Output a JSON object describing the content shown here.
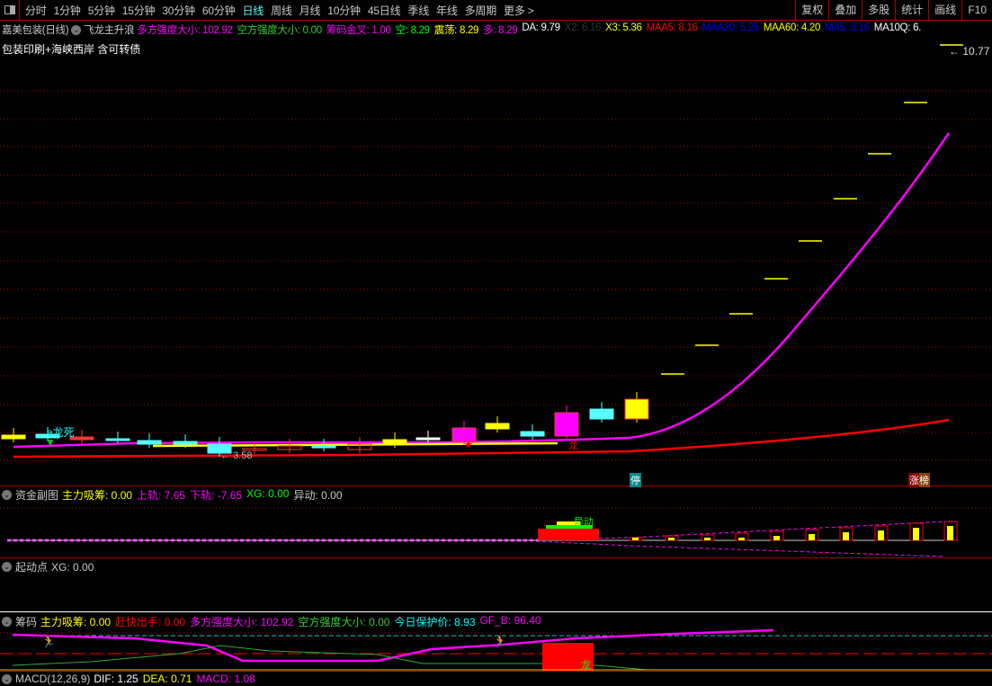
{
  "toolbar": {
    "periods": [
      "分时",
      "1分钟",
      "5分钟",
      "15分钟",
      "30分钟",
      "60分钟",
      "日线",
      "周线",
      "月线",
      "10分钟",
      "45日线",
      "季线",
      "年线",
      "多周期",
      "更多 >"
    ],
    "active": "日线",
    "right_buttons": [
      "复权",
      "叠加",
      "多股",
      "统计",
      "画线",
      "F10"
    ]
  },
  "main": {
    "title": "嘉美包装(日线)",
    "indicator": "飞龙主升浪",
    "values": [
      {
        "label": "多方强度大小: 102.92",
        "color": "#ff00ff"
      },
      {
        "label": "空方强度大小: 0.00",
        "color": "#33cc33"
      },
      {
        "label": "筹码金叉: 1.00",
        "color": "#ff00ff"
      },
      {
        "label": "空: 8.29",
        "color": "#00ff00"
      },
      {
        "label": "震荡: 8.29",
        "color": "#ffff00"
      },
      {
        "label": "多: 8.29",
        "color": "#ff00ff"
      },
      {
        "label": "DA: 9.79",
        "color": "#ffffff"
      },
      {
        "label": "X2: 6.16",
        "color": "#333333"
      },
      {
        "label": "X3: 5.36",
        "color": "#ffff00"
      },
      {
        "label": "MAA5: 8.16",
        "color": "#ff0000"
      },
      {
        "label": "MAA20: 5.26",
        "color": "#0000ff"
      },
      {
        "label": "MAA60: 4.20",
        "color": "#ffff00"
      },
      {
        "label": "MA5: 8.16",
        "color": "#0000ff"
      },
      {
        "label": "MA10Q: 6.",
        "color": "#ffffff"
      }
    ],
    "concept": "包装印刷+海峡西岸 含可转债",
    "high_label": "10.77",
    "low_label": "3.58",
    "signal_dragon_death": "e龙死",
    "stop_badge": "停",
    "limit_badge": "涨榜",
    "star_label": "龙"
  },
  "panel_fund": {
    "title": "资金副图",
    "values": [
      {
        "label": "主力吸筹: 0.00",
        "color": "#ffff00"
      },
      {
        "label": "上轨: 7.65",
        "color": "#ff00ff"
      },
      {
        "label": "下轨: -7.65",
        "color": "#ff00ff"
      },
      {
        "label": "XG: 0.00",
        "color": "#00ff00"
      },
      {
        "label": "异动: 0.00",
        "color": "#c8c8c8"
      }
    ],
    "mark": "异动"
  },
  "panel_start": {
    "title": "起动点",
    "values": [
      {
        "label": "XG: 0.00",
        "color": "#c8c8c8"
      }
    ]
  },
  "panel_chip": {
    "title": "筹码",
    "values": [
      {
        "label": "主力吸筹: 0.00",
        "color": "#ffff00"
      },
      {
        "label": "赶快出手: 0.00",
        "color": "#ff0000"
      },
      {
        "label": "多方强度大小: 102.92",
        "color": "#ff00ff"
      },
      {
        "label": "空方强度大小: 0.00",
        "color": "#33cc33"
      },
      {
        "label": "今日保护价: 8.93",
        "color": "#00ffff"
      },
      {
        "label": "GF_B: 96.40",
        "color": "#ff00ff"
      }
    ],
    "mark": "龙"
  },
  "panel_macd": {
    "title": "MACD(12,26,9)",
    "values": [
      {
        "label": "DIF: 1.25",
        "color": "#ffffff"
      },
      {
        "label": "DEA: 0.71",
        "color": "#ffff00"
      },
      {
        "label": "MACD: 1.08",
        "color": "#ff00ff"
      }
    ]
  }
}
